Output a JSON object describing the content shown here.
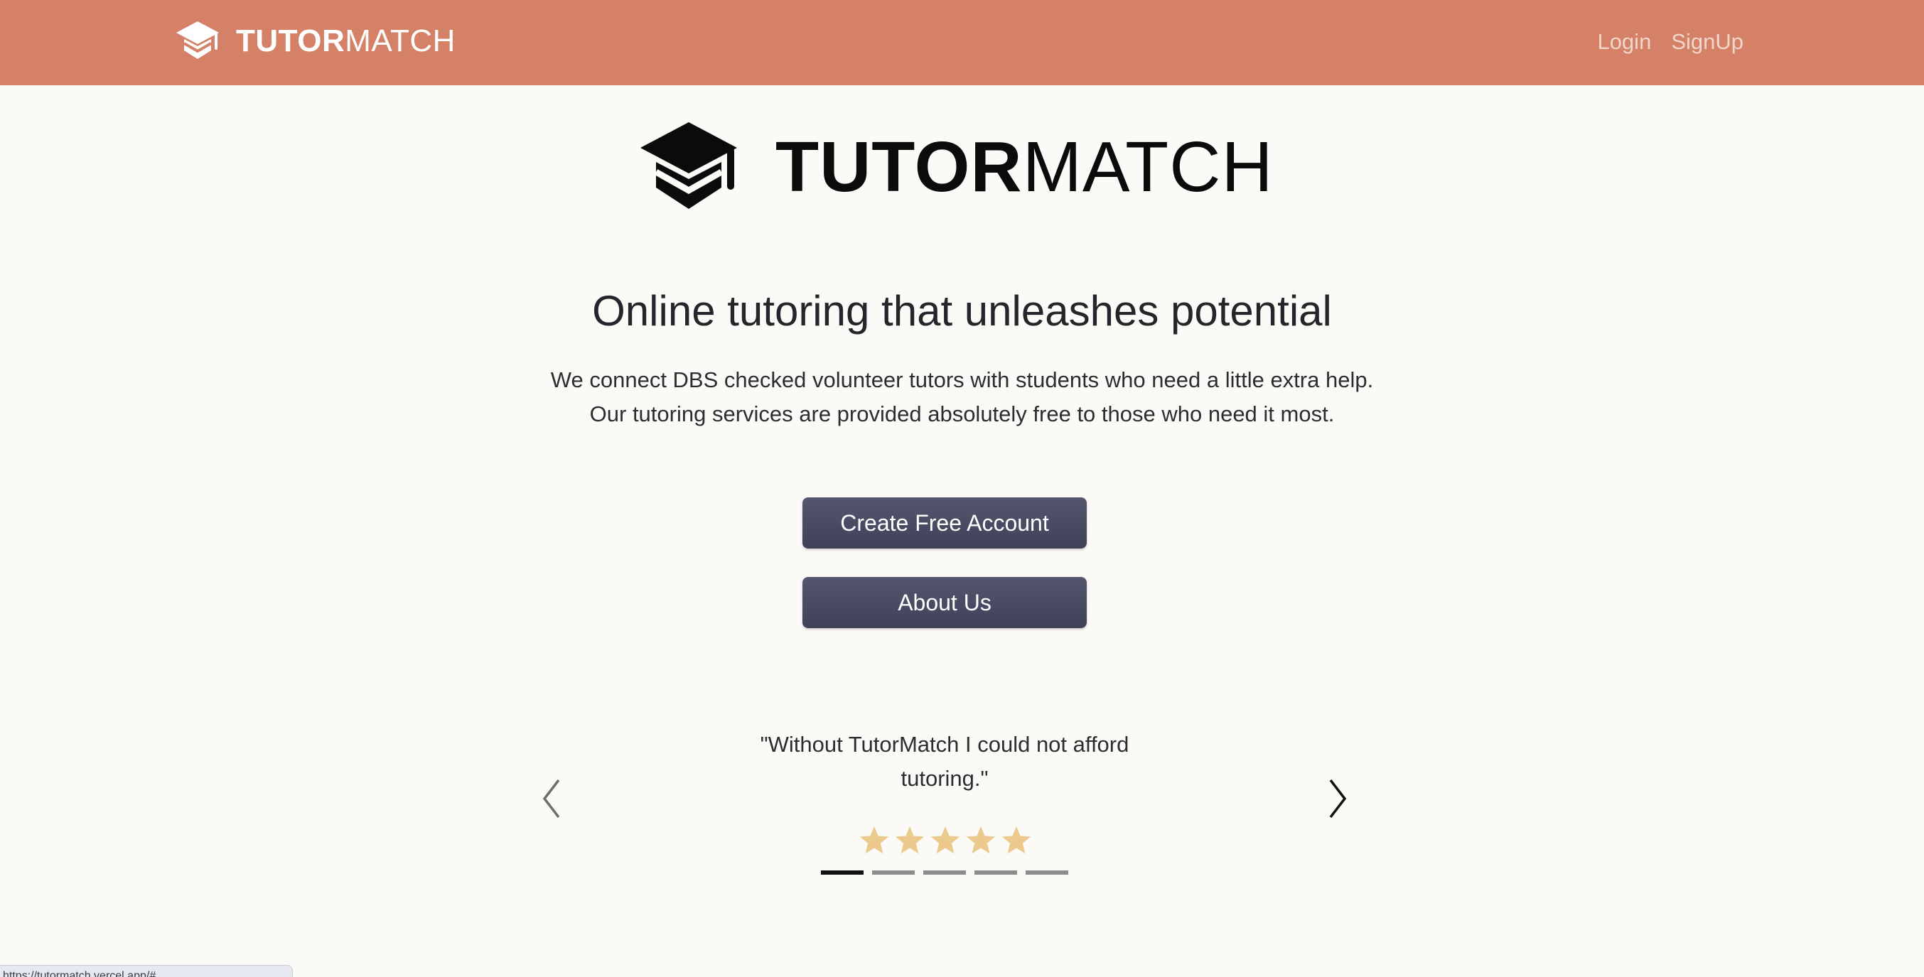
{
  "navbar": {
    "brand": {
      "bold": "TUTOR",
      "light": "MATCH",
      "icon": "graduation-cap-icon"
    },
    "links": [
      {
        "label": "Login"
      },
      {
        "label": "SignUp"
      }
    ],
    "background": "#d48167"
  },
  "hero": {
    "logo": {
      "bold": "TUTOR",
      "light": "MATCH",
      "icon": "graduation-cap-icon"
    },
    "headline": "Online tutoring that unleashes potential",
    "intro": [
      "We connect DBS checked volunteer tutors with students who need a little extra help.",
      "Our tutoring services are provided absolutely free to those who need it most."
    ]
  },
  "actions": {
    "create_account": "Create Free Account",
    "about_us": "About Us"
  },
  "testimonial": {
    "quote": "\"Without TutorMatch I could not afford tutoring.\"",
    "rating": 5,
    "rating_max": 5,
    "slide_count": 5,
    "active_slide": 1,
    "prev_icon": "chevron-left-icon",
    "next_icon": "chevron-right-icon",
    "star_color": "#ecc98c"
  },
  "status_bar": {
    "url": "https://tutormatch.vercel.app/#"
  }
}
